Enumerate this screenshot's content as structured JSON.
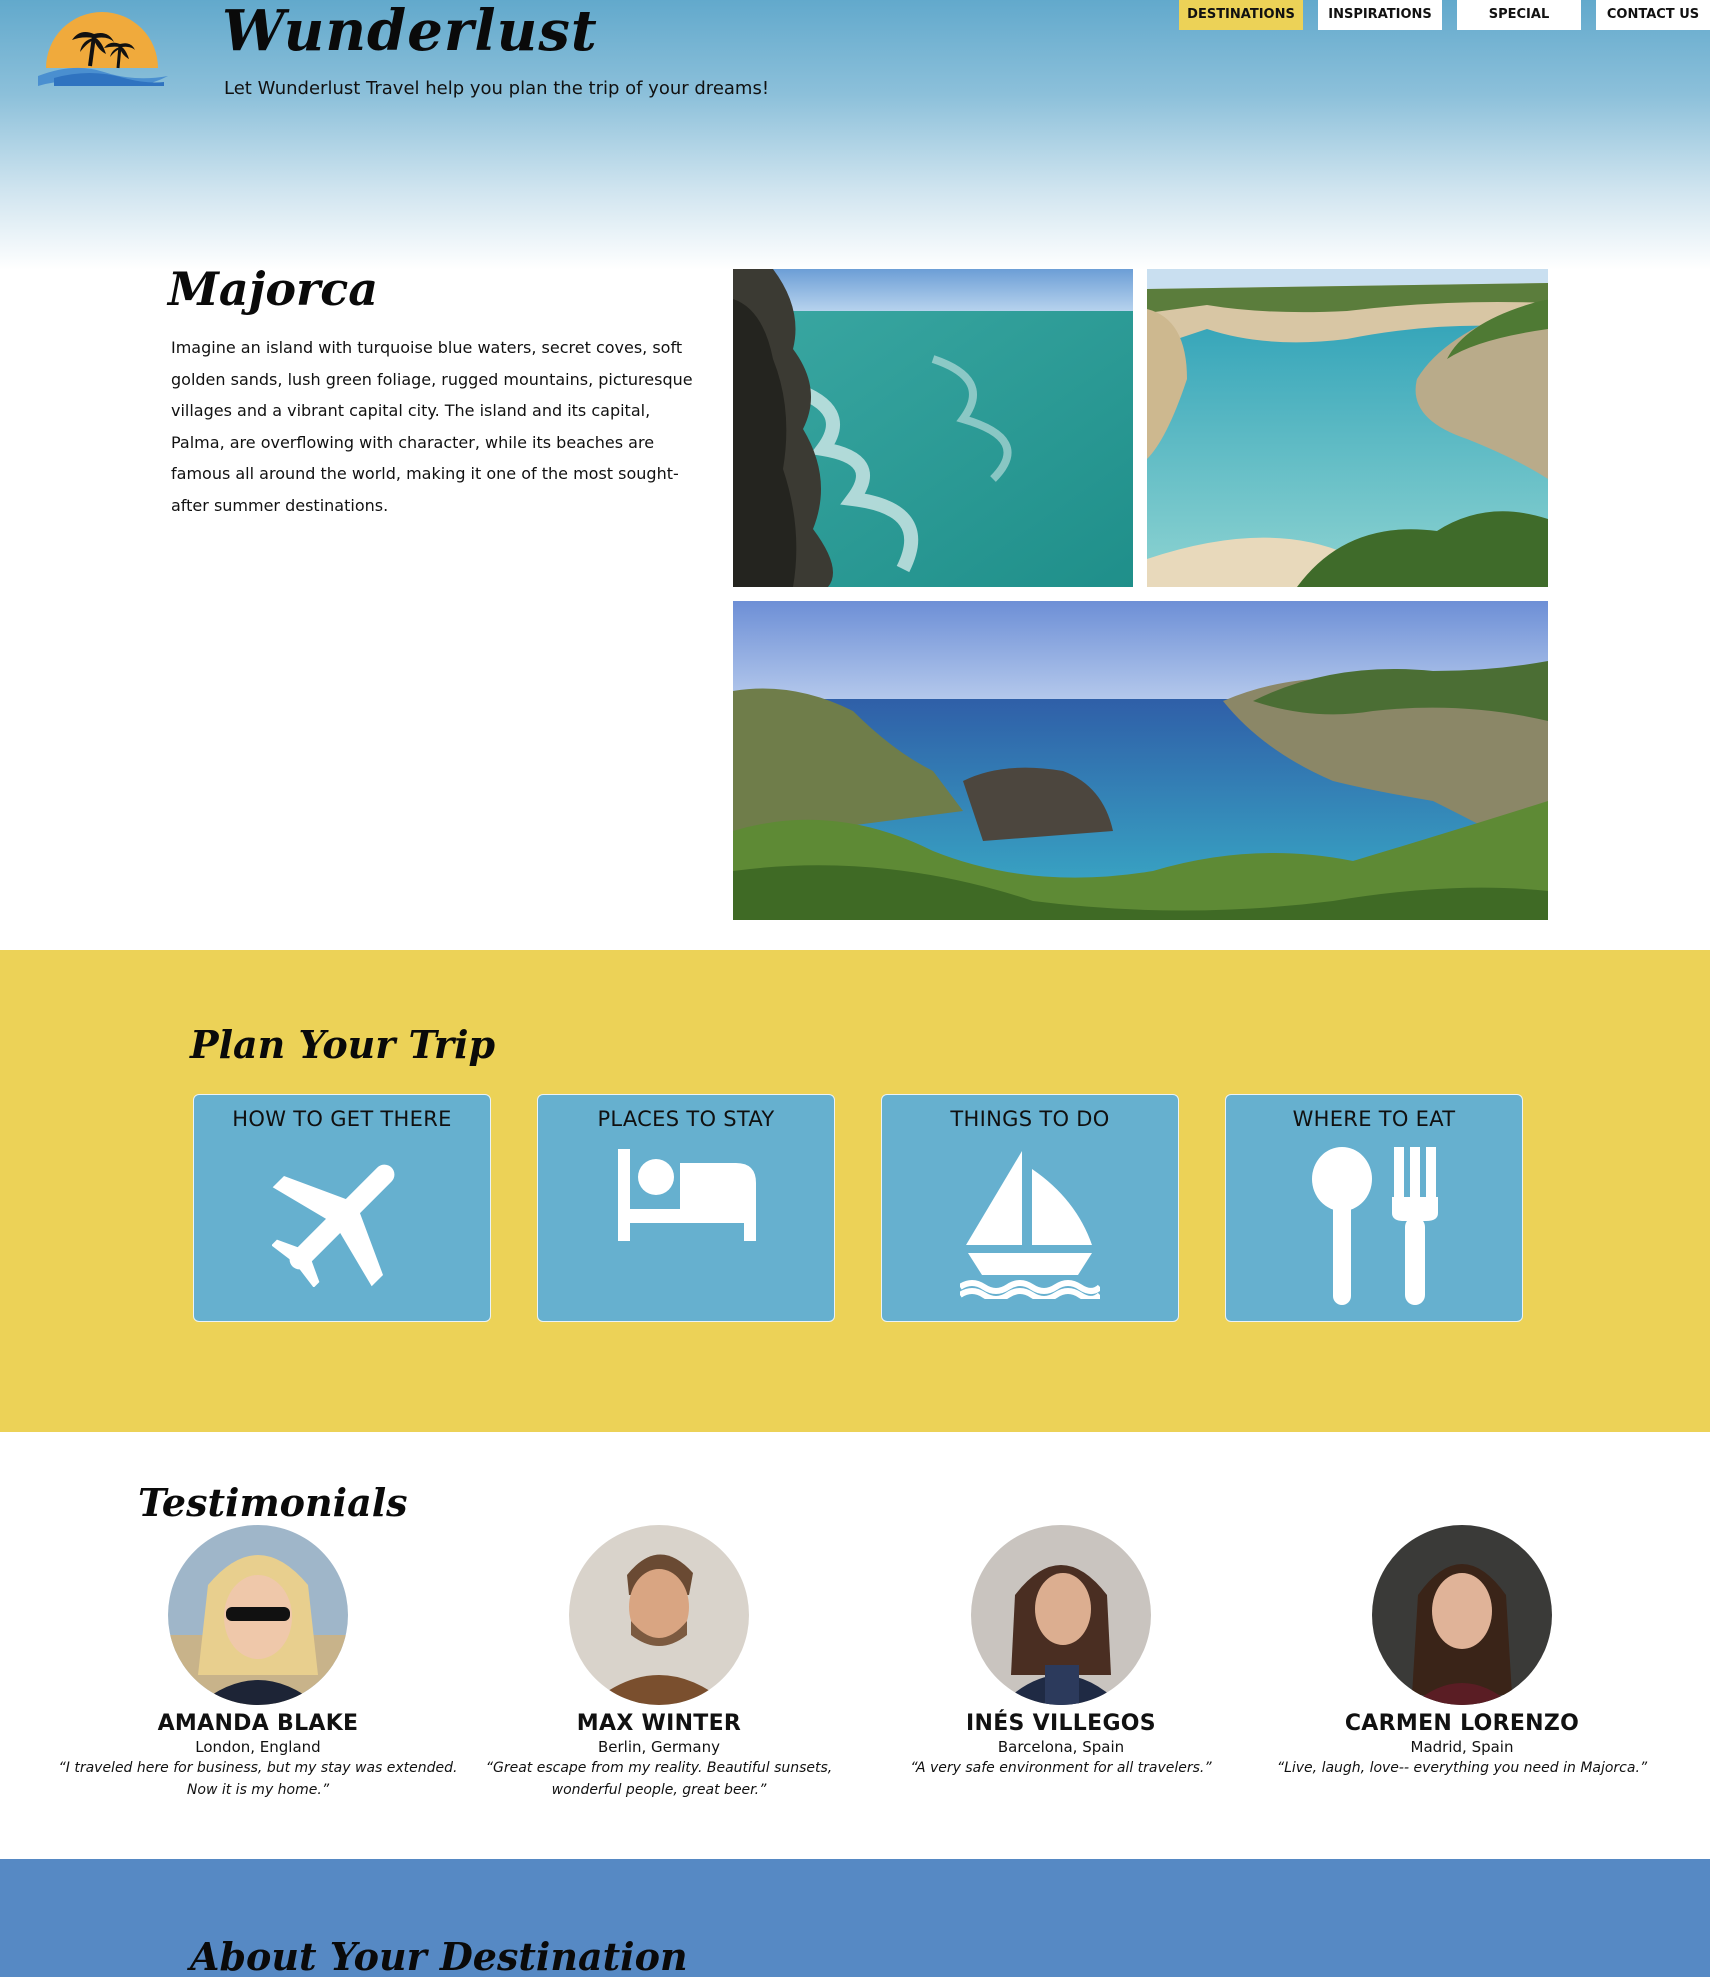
{
  "header": {
    "brand": "Wunderlust",
    "tagline": "Let Wunderlust Travel help you plan the trip of your dreams!"
  },
  "nav": [
    {
      "label": "DESTINATIONS",
      "active": true
    },
    {
      "label": "INSPIRATIONS",
      "active": false
    },
    {
      "label": "SPECIAL",
      "active": false
    },
    {
      "label": "CONTACT US",
      "active": false
    }
  ],
  "destination": {
    "title": "Majorca",
    "description": "Imagine an island with turquoise blue waters, secret coves, soft golden sands, lush green foliage, rugged mountains, picturesque villages and a vibrant capital city. The island and its capital, Palma, are overflowing with character, while its beaches are famous all around the world, making it one of the most sought-after summer destinations."
  },
  "plan": {
    "title": "Plan Your Trip",
    "cards": [
      {
        "label": "HOW TO GET THERE",
        "icon": "airplane-icon"
      },
      {
        "label": "PLACES TO STAY",
        "icon": "bed-icon"
      },
      {
        "label": "THINGS TO DO",
        "icon": "sailboat-icon"
      },
      {
        "label": "WHERE TO EAT",
        "icon": "spoon-fork-icon"
      }
    ]
  },
  "testimonials": {
    "title": "Testimonials",
    "people": [
      {
        "name": "AMANDA BLAKE",
        "location": "London, England",
        "quote": "“I traveled here for business, but my stay was extended. Now it is my home.”"
      },
      {
        "name": "MAX WINTER",
        "location": "Berlin, Germany",
        "quote": "“Great escape from my reality. Beautiful sunsets, wonderful people, great beer.”"
      },
      {
        "name": "INÉS VILLEGOS",
        "location": "Barcelona, Spain",
        "quote": "“A very safe environment for all travelers.”"
      },
      {
        "name": "CARMEN LORENZO",
        "location": "Madrid, Spain",
        "quote": "“Live, laugh, love-- everything you need in Majorca.”"
      }
    ]
  },
  "about": {
    "title": "About Your Destination"
  },
  "colors": {
    "header_blue": "#62a9cc",
    "nav_active": "#ecd257",
    "plan_yellow": "#ecd257",
    "card_blue": "#66b0cf",
    "about_blue": "#5689c4"
  }
}
